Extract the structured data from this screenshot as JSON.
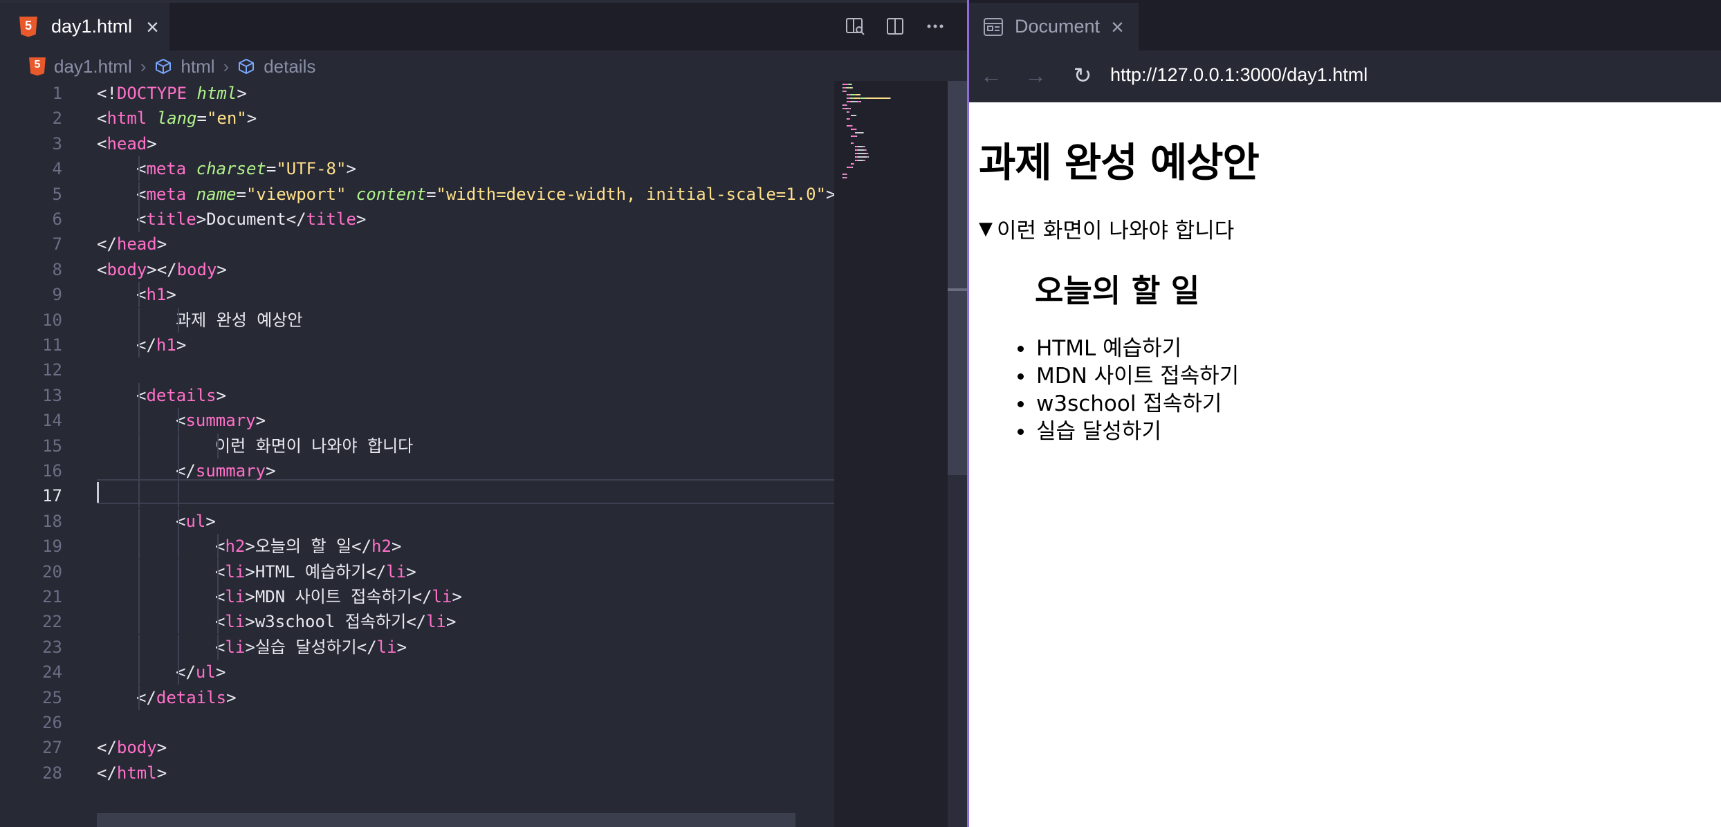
{
  "editor": {
    "tab_title": "day1.html",
    "breadcrumb": [
      "day1.html",
      "html",
      "details"
    ],
    "active_line": 17,
    "lines": [
      {
        "n": "1",
        "indent": 0,
        "seg": [
          [
            "br",
            "<!"
          ],
          [
            "tg",
            "DOCTYPE"
          ],
          [
            "br",
            " "
          ],
          [
            "at",
            "html"
          ],
          [
            "br",
            ">"
          ]
        ]
      },
      {
        "n": "2",
        "indent": 0,
        "seg": [
          [
            "br",
            "<"
          ],
          [
            "tg",
            "html"
          ],
          [
            "br",
            " "
          ],
          [
            "at",
            "lang"
          ],
          [
            "br",
            "="
          ],
          [
            "st",
            "\"en\""
          ],
          [
            "br",
            ">"
          ]
        ]
      },
      {
        "n": "3",
        "indent": 0,
        "seg": [
          [
            "br",
            "<"
          ],
          [
            "tg",
            "head"
          ],
          [
            "br",
            ">"
          ]
        ]
      },
      {
        "n": "4",
        "indent": 1,
        "seg": [
          [
            "br",
            "<"
          ],
          [
            "tg",
            "meta"
          ],
          [
            "br",
            " "
          ],
          [
            "at",
            "charset"
          ],
          [
            "br",
            "="
          ],
          [
            "st",
            "\"UTF-8\""
          ],
          [
            "br",
            ">"
          ]
        ]
      },
      {
        "n": "5",
        "indent": 1,
        "seg": [
          [
            "br",
            "<"
          ],
          [
            "tg",
            "meta"
          ],
          [
            "br",
            " "
          ],
          [
            "at",
            "name"
          ],
          [
            "br",
            "="
          ],
          [
            "st",
            "\"viewport\""
          ],
          [
            "br",
            " "
          ],
          [
            "at",
            "content"
          ],
          [
            "br",
            "="
          ],
          [
            "st",
            "\"width=device-width, initial-scale=1.0\""
          ],
          [
            "br",
            ">"
          ]
        ]
      },
      {
        "n": "6",
        "indent": 1,
        "seg": [
          [
            "br",
            "<"
          ],
          [
            "tg",
            "title"
          ],
          [
            "br",
            ">"
          ],
          [
            "dt",
            "Document"
          ],
          [
            "br",
            "</"
          ],
          [
            "tg",
            "title"
          ],
          [
            "br",
            ">"
          ]
        ]
      },
      {
        "n": "7",
        "indent": 0,
        "seg": [
          [
            "br",
            "</"
          ],
          [
            "tg",
            "head"
          ],
          [
            "br",
            ">"
          ]
        ]
      },
      {
        "n": "8",
        "indent": 0,
        "seg": [
          [
            "br",
            "<"
          ],
          [
            "tg",
            "body"
          ],
          [
            "br",
            "></"
          ],
          [
            "tg",
            "body"
          ],
          [
            "br",
            ">"
          ]
        ]
      },
      {
        "n": "9",
        "indent": 1,
        "seg": [
          [
            "br",
            "<"
          ],
          [
            "tg",
            "h1"
          ],
          [
            "br",
            ">"
          ]
        ]
      },
      {
        "n": "10",
        "indent": 2,
        "seg": [
          [
            "dt",
            "과제 완성 예상안"
          ]
        ]
      },
      {
        "n": "11",
        "indent": 1,
        "seg": [
          [
            "br",
            "</"
          ],
          [
            "tg",
            "h1"
          ],
          [
            "br",
            ">"
          ]
        ]
      },
      {
        "n": "12",
        "indent": 0,
        "seg": []
      },
      {
        "n": "13",
        "indent": 1,
        "seg": [
          [
            "br",
            "<"
          ],
          [
            "tg",
            "details"
          ],
          [
            "br",
            ">"
          ]
        ]
      },
      {
        "n": "14",
        "indent": 2,
        "seg": [
          [
            "br",
            "<"
          ],
          [
            "tg",
            "summary"
          ],
          [
            "br",
            ">"
          ]
        ]
      },
      {
        "n": "15",
        "indent": 3,
        "seg": [
          [
            "dt",
            "이런 화면이 나와야 합니다"
          ]
        ]
      },
      {
        "n": "16",
        "indent": 2,
        "seg": [
          [
            "br",
            "</"
          ],
          [
            "tg",
            "summary"
          ],
          [
            "br",
            ">"
          ]
        ]
      },
      {
        "n": "17",
        "indent": 0,
        "seg": []
      },
      {
        "n": "18",
        "indent": 2,
        "seg": [
          [
            "br",
            "<"
          ],
          [
            "tg",
            "ul"
          ],
          [
            "br",
            ">"
          ]
        ]
      },
      {
        "n": "19",
        "indent": 3,
        "seg": [
          [
            "br",
            "<"
          ],
          [
            "tg",
            "h2"
          ],
          [
            "br",
            ">"
          ],
          [
            "dt",
            "오늘의 할 일"
          ],
          [
            "br",
            "</"
          ],
          [
            "tg",
            "h2"
          ],
          [
            "br",
            ">"
          ]
        ]
      },
      {
        "n": "20",
        "indent": 3,
        "seg": [
          [
            "br",
            "<"
          ],
          [
            "tg",
            "li"
          ],
          [
            "br",
            ">"
          ],
          [
            "dt",
            "HTML 예습하기"
          ],
          [
            "br",
            "</"
          ],
          [
            "tg",
            "li"
          ],
          [
            "br",
            ">"
          ]
        ]
      },
      {
        "n": "21",
        "indent": 3,
        "seg": [
          [
            "br",
            "<"
          ],
          [
            "tg",
            "li"
          ],
          [
            "br",
            ">"
          ],
          [
            "dt",
            "MDN 사이트 접속하기"
          ],
          [
            "br",
            "</"
          ],
          [
            "tg",
            "li"
          ],
          [
            "br",
            ">"
          ]
        ]
      },
      {
        "n": "22",
        "indent": 3,
        "seg": [
          [
            "br",
            "<"
          ],
          [
            "tg",
            "li"
          ],
          [
            "br",
            ">"
          ],
          [
            "dt",
            "w3school 접속하기"
          ],
          [
            "br",
            "</"
          ],
          [
            "tg",
            "li"
          ],
          [
            "br",
            ">"
          ]
        ]
      },
      {
        "n": "23",
        "indent": 3,
        "seg": [
          [
            "br",
            "<"
          ],
          [
            "tg",
            "li"
          ],
          [
            "br",
            ">"
          ],
          [
            "dt",
            "실습 달성하기"
          ],
          [
            "br",
            "</"
          ],
          [
            "tg",
            "li"
          ],
          [
            "br",
            ">"
          ]
        ]
      },
      {
        "n": "24",
        "indent": 2,
        "seg": [
          [
            "br",
            "</"
          ],
          [
            "tg",
            "ul"
          ],
          [
            "br",
            ">"
          ]
        ]
      },
      {
        "n": "25",
        "indent": 1,
        "seg": [
          [
            "br",
            "</"
          ],
          [
            "tg",
            "details"
          ],
          [
            "br",
            ">"
          ]
        ]
      },
      {
        "n": "26",
        "indent": 0,
        "seg": []
      },
      {
        "n": "27",
        "indent": 0,
        "seg": [
          [
            "br",
            "</"
          ],
          [
            "tg",
            "body"
          ],
          [
            "br",
            ">"
          ]
        ]
      },
      {
        "n": "28",
        "indent": 0,
        "seg": [
          [
            "br",
            "</"
          ],
          [
            "tg",
            "html"
          ],
          [
            "br",
            ">"
          ]
        ]
      }
    ],
    "guides": [
      [
        4,
        6,
        1
      ],
      [
        9,
        11,
        1
      ],
      [
        10,
        10,
        2
      ],
      [
        13,
        25,
        1
      ],
      [
        14,
        24,
        2
      ],
      [
        15,
        15,
        3
      ],
      [
        19,
        23,
        3
      ]
    ]
  },
  "browser": {
    "tab_title": "Document",
    "url": "http://127.0.0.1:3000/day1.html",
    "page": {
      "h1": "과제 완성 예상안",
      "summary_marker": "▼",
      "summary": "이런 화면이 나와야 합니다",
      "h2": "오늘의 할 일",
      "items": [
        "HTML 예습하기",
        "MDN 사이트 접속하기",
        "w3school 접속하기",
        "실습 달성하기"
      ]
    }
  },
  "colors": {
    "tag": "#ff71c9",
    "attribute": "#b0f28a",
    "string": "#ffe08a",
    "accent_border": "#8f6bdc",
    "html5_badge": "#e8592c"
  },
  "icons": [
    "html5-file-icon",
    "close-icon",
    "open-preview-icon",
    "split-editor-icon",
    "more-actions-icon",
    "chevron-right-icon",
    "symbol-cube-icon",
    "browser-preview-icon",
    "back-arrow-icon",
    "forward-arrow-icon",
    "reload-icon"
  ]
}
